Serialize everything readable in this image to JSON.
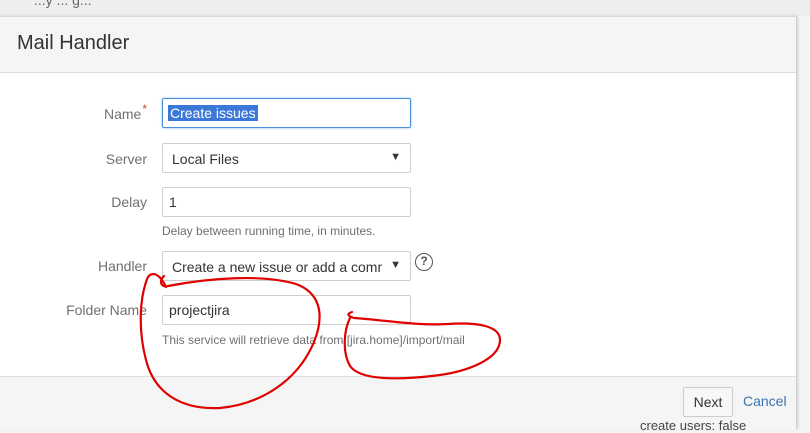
{
  "background": {
    "top_text": "...y ... g...",
    "bottom_text": "create users: false"
  },
  "dialog": {
    "title": "Mail Handler"
  },
  "form": {
    "name": {
      "label": "Name",
      "required_marker": "*",
      "value": "Create issues"
    },
    "server": {
      "label": "Server",
      "value": "Local Files"
    },
    "delay": {
      "label": "Delay",
      "value": "1",
      "hint": "Delay between running time, in minutes."
    },
    "handler": {
      "label": "Handler",
      "value": "Create a new issue or add a comment to an existing issue"
    },
    "folder": {
      "label": "Folder Name",
      "value": "projectjira",
      "hint": "This service will retrieve data from [jira.home]/import/mail"
    }
  },
  "footer": {
    "next_label": "Next",
    "cancel_label": "Cancel"
  },
  "icons": {
    "help": "question-circle-icon",
    "dropdown": "caret-down-icon"
  },
  "colors": {
    "accent_link": "#3b73af",
    "required": "#d04437",
    "annotation": "#e00000",
    "selection": "#3c78d8"
  }
}
